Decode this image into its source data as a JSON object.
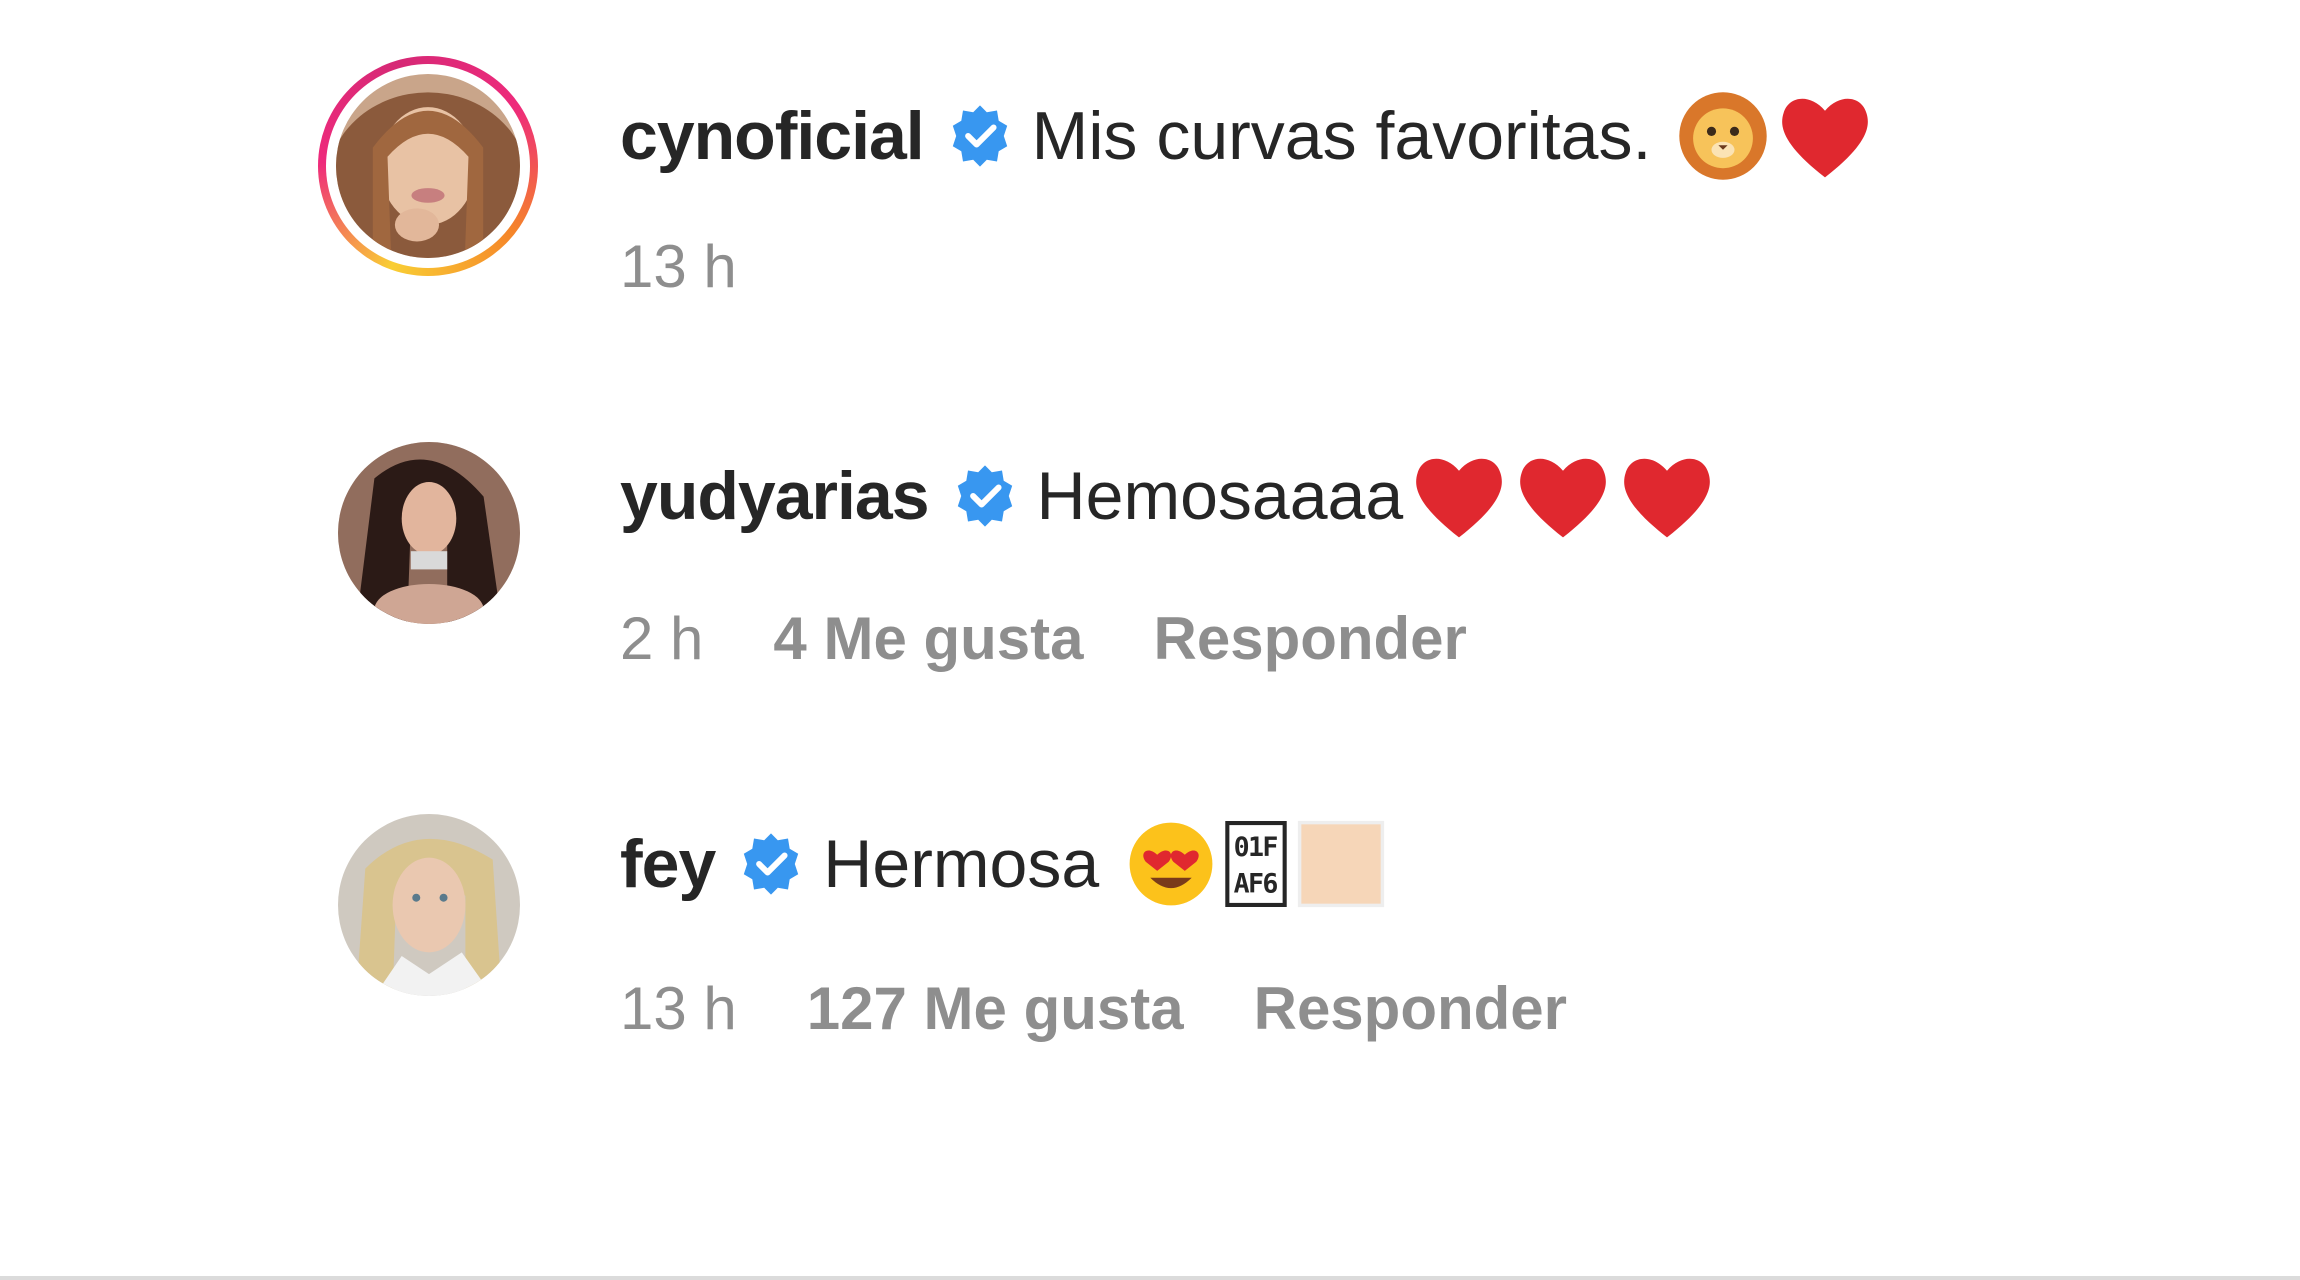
{
  "comments": [
    {
      "username": "cynoficial",
      "verified": true,
      "text": "Mis curvas favoritas.",
      "emojis": [
        "lion-face",
        "red-heart"
      ],
      "time": "13 h",
      "has_story_ring": true
    },
    {
      "username": "yudyarias",
      "verified": true,
      "text": "Hemosaaaa",
      "emojis": [
        "red-heart",
        "red-heart",
        "red-heart"
      ],
      "time": "2 h",
      "likes": "4 Me gusta",
      "reply": "Responder"
    },
    {
      "username": "fey",
      "verified": true,
      "text": "Hermosa",
      "emojis": [
        "heart-eyes-face",
        "missing-glyph-box",
        "skin-tone-swatch"
      ],
      "missing_glyph_code": [
        "0",
        "1",
        "F",
        "A",
        "F",
        "6"
      ],
      "time": "13 h",
      "likes": "127 Me gusta",
      "reply": "Responder"
    }
  ],
  "colors": {
    "text": "#262626",
    "secondary": "#8e8e8e",
    "verified_blue": "#3897f0",
    "heart_red": "#e0282f"
  }
}
